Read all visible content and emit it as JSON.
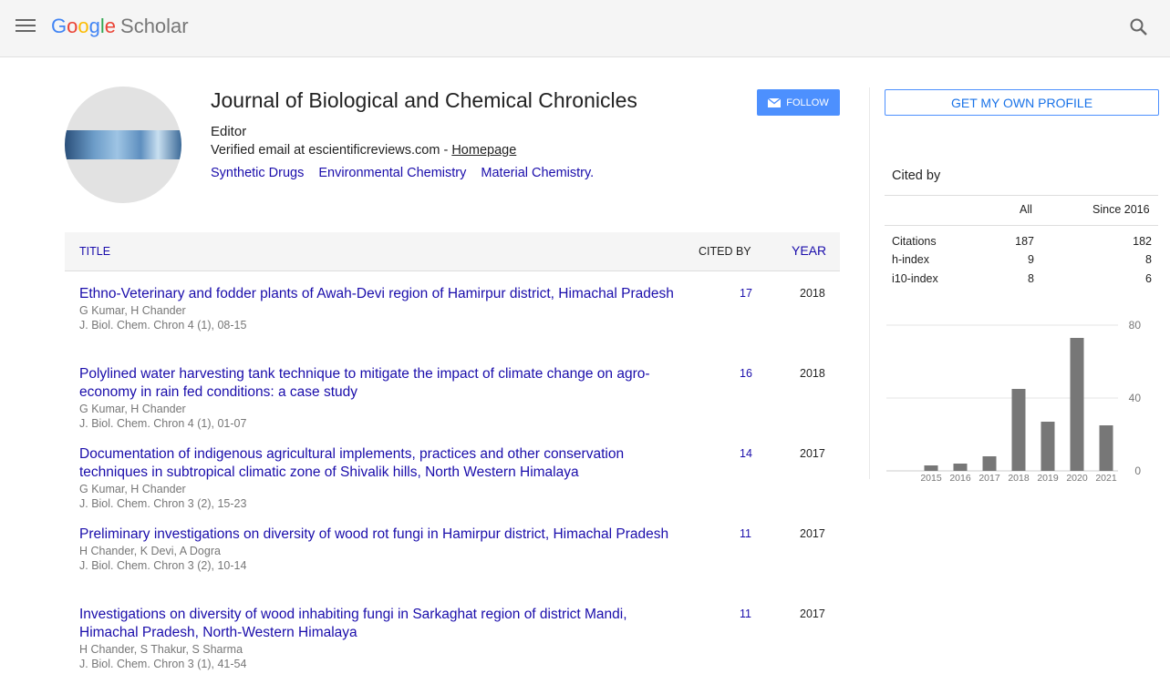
{
  "header": {
    "logo_letters": [
      "G",
      "o",
      "o",
      "g",
      "l",
      "e"
    ],
    "product": "Scholar"
  },
  "profile": {
    "name": "Journal of Biological and Chemical Chronicles",
    "affiliation": "Editor",
    "email_text": "Verified email at escientificreviews.com - ",
    "homepage_label": "Homepage",
    "interests": [
      "Synthetic Drugs",
      "Environmental Chemistry",
      "Material Chemistry."
    ],
    "follow_label": "FOLLOW"
  },
  "table": {
    "headers": {
      "title": "TITLE",
      "cited_by": "CITED BY",
      "year": "YEAR"
    },
    "articles": [
      {
        "title": "Ethno-Veterinary and fodder plants of Awah-Devi region of Hamirpur district, Himachal Pradesh",
        "authors": "G Kumar, H Chander",
        "venue": "J. Biol. Chem. Chron 4 (1), 08-15",
        "cited": "17",
        "year": "2018"
      },
      {
        "title": "Polylined water harvesting tank technique to mitigate the impact of climate change on agro-economy in rain fed conditions: a case study",
        "authors": "G Kumar, H Chander",
        "venue": "J. Biol. Chem. Chron 4 (1), 01-07",
        "cited": "16",
        "year": "2018"
      },
      {
        "title": "Documentation of indigenous agricultural implements, practices and other conservation techniques in subtropical climatic zone of Shivalik hills, North Western Himalaya",
        "authors": "G Kumar, H Chander",
        "venue": "J. Biol. Chem. Chron 3 (2), 15-23",
        "cited": "14",
        "year": "2017"
      },
      {
        "title": "Preliminary investigations on diversity of wood rot fungi in Hamirpur district, Himachal Pradesh",
        "authors": "H Chander, K Devi, A Dogra",
        "venue": "J. Biol. Chem. Chron 3 (2), 10-14",
        "cited": "11",
        "year": "2017"
      },
      {
        "title": "Investigations on diversity of wood inhabiting fungi in Sarkaghat region of district Mandi, Himachal Pradesh, North-Western Himalaya",
        "authors": "H Chander, S Thakur, S Sharma",
        "venue": "J. Biol. Chem. Chron 3 (1), 41-54",
        "cited": "11",
        "year": "2017"
      }
    ]
  },
  "sidebar": {
    "own_profile_label": "GET MY OWN PROFILE",
    "cited_by_title": "Cited by",
    "col_all": "All",
    "col_since": "Since 2016",
    "stats": [
      {
        "label": "Citations",
        "all": "187",
        "since": "182"
      },
      {
        "label": "h-index",
        "all": "9",
        "since": "8"
      },
      {
        "label": "i10-index",
        "all": "8",
        "since": "6"
      }
    ]
  },
  "colors": {
    "link": "#1a0dab",
    "accent": "#4d90fe",
    "bar": "#777777"
  },
  "chart_data": {
    "type": "bar",
    "categories": [
      "2015",
      "2016",
      "2017",
      "2018",
      "2019",
      "2020",
      "2021"
    ],
    "values": [
      3,
      4,
      8,
      45,
      27,
      73,
      25
    ],
    "yticks": [
      "80",
      "40",
      "0"
    ],
    "ylim": [
      0,
      80
    ],
    "grid": true,
    "ylabel": "",
    "xlabel": ""
  }
}
